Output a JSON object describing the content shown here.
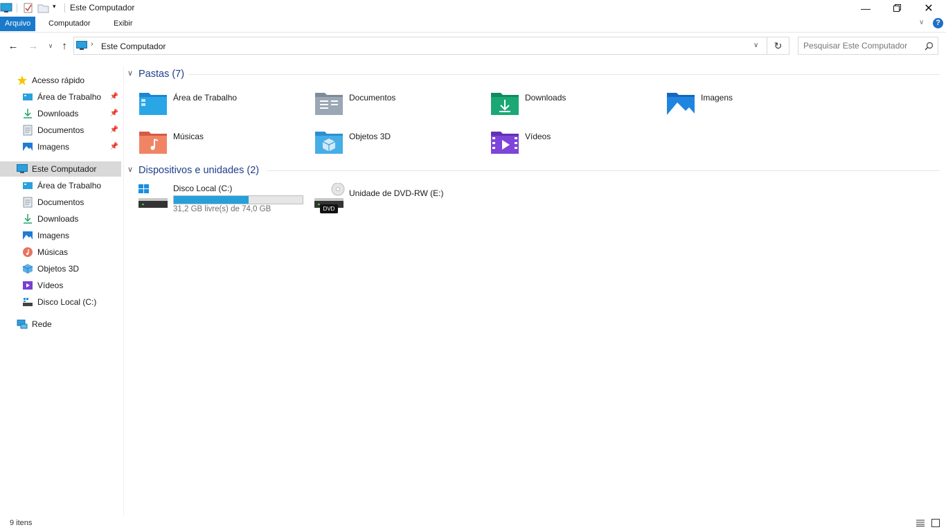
{
  "window": {
    "title": "Este Computador"
  },
  "ribbon": {
    "tabs": [
      "Arquivo",
      "Computador",
      "Exibir"
    ]
  },
  "address": {
    "location": "Este Computador",
    "search_placeholder": "Pesquisar Este Computador"
  },
  "sidebar": {
    "quick_access": {
      "label": "Acesso rápido",
      "items": [
        "Área de Trabalho",
        "Downloads",
        "Documentos",
        "Imagens"
      ]
    },
    "this_pc": {
      "label": "Este Computador",
      "items": [
        "Área de Trabalho",
        "Documentos",
        "Downloads",
        "Imagens",
        "Músicas",
        "Objetos 3D",
        "Vídeos",
        "Disco Local (C:)"
      ]
    },
    "network": {
      "label": "Rede"
    }
  },
  "content": {
    "folders_group": "Pastas (7)",
    "folders": [
      "Área de Trabalho",
      "Documentos",
      "Downloads",
      "Imagens",
      "Músicas",
      "Objetos 3D",
      "Vídeos"
    ],
    "devices_group": "Dispositivos e unidades (2)",
    "drive_c": {
      "name": "Disco Local (C:)",
      "free_text": "31,2 GB livre(s) de 74,0 GB",
      "used_fraction": 0.578
    },
    "drive_e": {
      "name": "Unidade de DVD-RW (E:)",
      "badge": "DVD"
    }
  },
  "status": {
    "count": "9 itens"
  },
  "colors": {
    "accent": "#1979ca",
    "bar": "#26a0da"
  }
}
